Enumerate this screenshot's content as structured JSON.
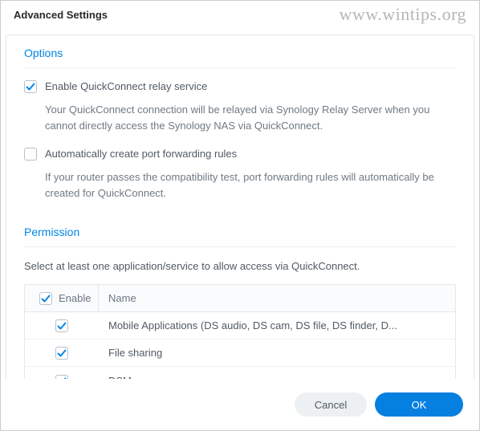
{
  "window": {
    "title": "Advanced Settings"
  },
  "watermark": "www.wintips.org",
  "options": {
    "header": "Options",
    "enable_relay": {
      "checked": true,
      "label": "Enable QuickConnect relay service",
      "help": "Your QuickConnect connection will be relayed via Synology Relay Server when you cannot directly access the Synology NAS via QuickConnect."
    },
    "auto_port": {
      "checked": false,
      "label": "Automatically create port forwarding rules",
      "help": "If your router passes the compatibility test, port forwarding rules will automatically be created for QuickConnect."
    }
  },
  "permission": {
    "header": "Permission",
    "description": "Select at least one application/service to allow access via QuickConnect.",
    "columns": {
      "enable": "Enable",
      "name": "Name"
    },
    "header_checked": true,
    "rows": [
      {
        "checked": true,
        "name": "Mobile Applications (DS audio, DS cam, DS file, DS finder, D..."
      },
      {
        "checked": true,
        "name": "File sharing"
      },
      {
        "checked": true,
        "name": "DSM"
      }
    ]
  },
  "footer": {
    "cancel": "Cancel",
    "ok": "OK"
  }
}
